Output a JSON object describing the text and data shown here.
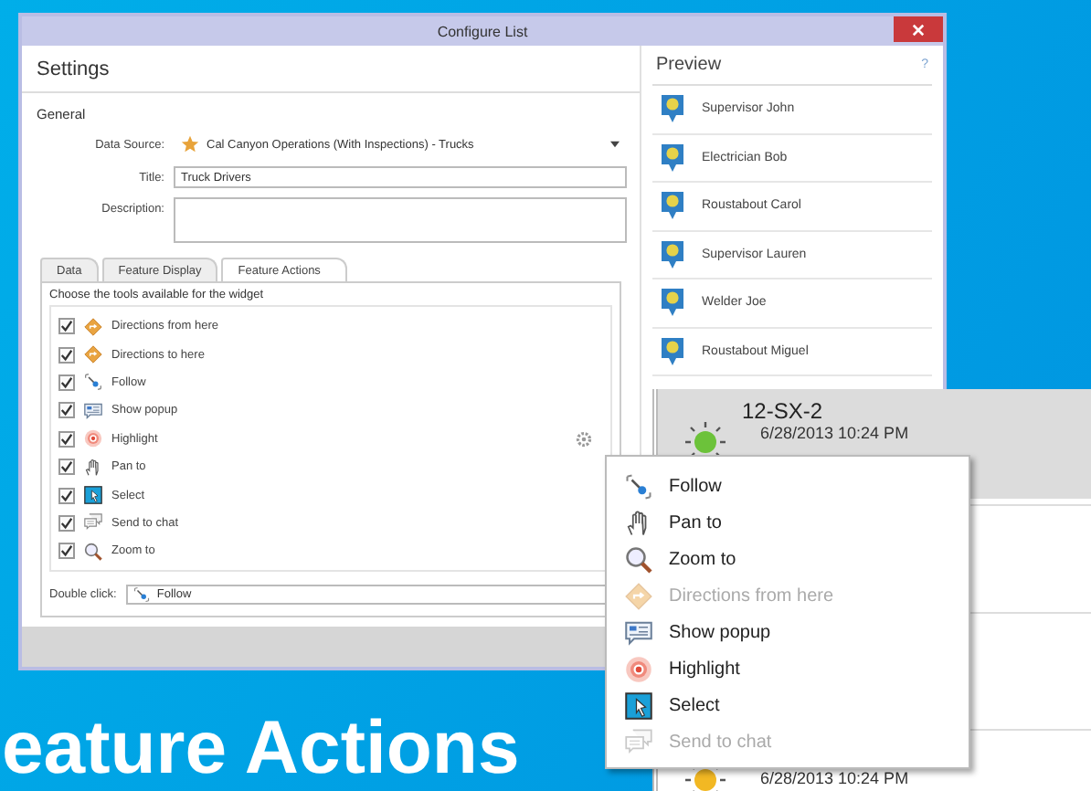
{
  "configure_window": {
    "title": "Configure List",
    "settings": {
      "heading": "Settings",
      "section": "General",
      "fields": [
        {
          "kind": "dropdown",
          "label": "Data Source:",
          "value": "Cal Canyon Operations (With Inspections) - Trucks"
        },
        {
          "kind": "text",
          "label": "Title:",
          "value": "Truck Drivers"
        },
        {
          "kind": "textarea",
          "label": "Description:"
        }
      ],
      "tabs": [
        {
          "label": "Data",
          "selected": false
        },
        {
          "label": "Feature Display",
          "selected": false
        },
        {
          "label": "Feature Actions",
          "selected": true
        }
      ],
      "instructions": "Choose the tools available for the widget",
      "tools": [
        {
          "label": "Directions from here",
          "checked": true,
          "configurable": false
        },
        {
          "label": "Directions to here",
          "checked": true,
          "configurable": false
        },
        {
          "label": "Follow",
          "checked": true,
          "configurable": false
        },
        {
          "label": "Show popup",
          "checked": true,
          "configurable": false
        },
        {
          "label": "Highlight",
          "checked": true,
          "configurable": true
        },
        {
          "label": "Pan to",
          "checked": true,
          "configurable": false
        },
        {
          "label": "Select",
          "checked": true,
          "configurable": false
        },
        {
          "label": "Send to chat",
          "checked": true,
          "configurable": false
        },
        {
          "label": "Zoom to",
          "checked": true,
          "configurable": false
        }
      ],
      "double_click": {
        "label": "Double click:",
        "value": "Follow"
      }
    },
    "preview": {
      "heading": "Preview",
      "help": "?",
      "items": [
        "Supervisor John",
        "Electrician Bob",
        "Roustabout Carol",
        "Supervisor Lauren",
        "Welder Joe",
        "Roustabout Miguel"
      ]
    }
  },
  "feed_panel": {
    "items": [
      {
        "title": "12-SX-2",
        "time": "6/28/2013 10:24 PM",
        "selected": true,
        "color": "#6cc23a"
      },
      {
        "time": "6/28/2013 10:24 PM",
        "selected": false,
        "color": "#f2b823"
      }
    ]
  },
  "context_menu": [
    {
      "label": "Follow",
      "disabled": false
    },
    {
      "label": "Pan to",
      "disabled": false
    },
    {
      "label": "Zoom to",
      "disabled": false
    },
    {
      "label": "Directions from here",
      "disabled": true
    },
    {
      "label": "Show popup",
      "disabled": false
    },
    {
      "label": "Highlight",
      "disabled": false
    },
    {
      "label": "Select",
      "disabled": false
    },
    {
      "label": "Send to chat",
      "disabled": true
    }
  ],
  "caption": "eature Actions"
}
